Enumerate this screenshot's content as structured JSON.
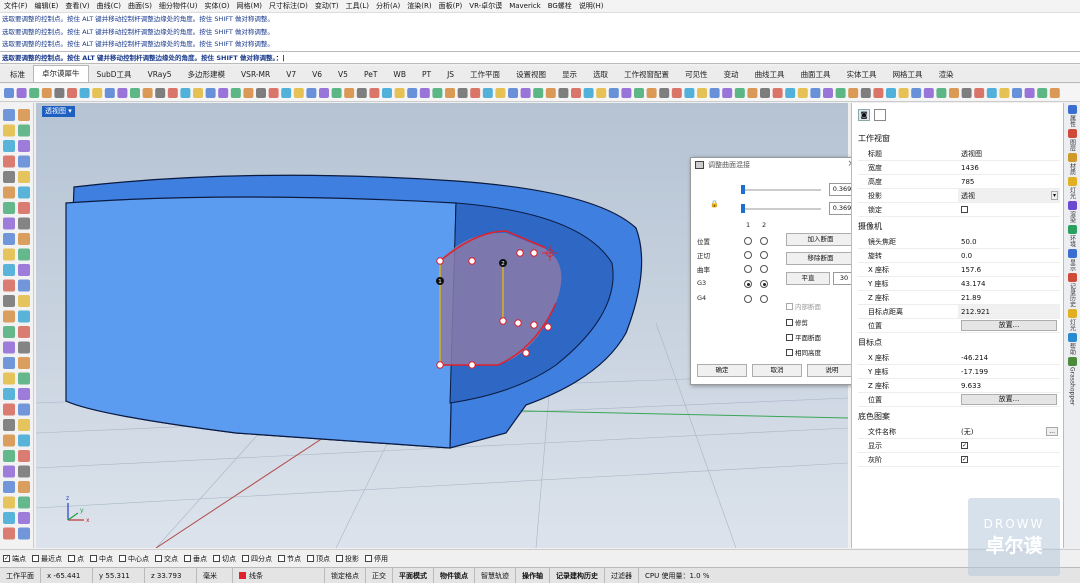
{
  "menu": [
    "文件(F)",
    "编辑(E)",
    "查看(V)",
    "曲线(C)",
    "曲面(S)",
    "细分物件(U)",
    "实体(O)",
    "网格(M)",
    "尺寸标注(D)",
    "变动(T)",
    "工具(L)",
    "分析(A)",
    "渲染(R)",
    "面板(P)",
    "VR-卓尔谟",
    "Maverick",
    "BG螺栓",
    "说明(H)"
  ],
  "command_history": [
    "选取要调整的控制点。按住 ALT 键并移动控制杆调整边缘处的角度。按住 SHIFT 做对称调整。",
    "选取要调整的控制点。按住 ALT 键并移动控制杆调整边缘处的角度。按住 SHIFT 做对称调整。",
    "选取要调整的控制点。按住 ALT 键并移动控制杆调整边缘处的角度。按住 SHIFT 做对称调整。",
    "选取要调整的控制点。按住 ALT 键并移动控制杆调整边缘处的角度。按住 SHIFT 做对称调整。"
  ],
  "command_prompt": "选取要调整的控制点。按住 ALT 键并移动控制杆调整边缘处的角度。按住 SHIFT 做对称调整。",
  "tabs": [
    "标准",
    "卓尔谟犀牛",
    "SubD工具",
    "VRay5",
    "多边形建模",
    "VSR-MR",
    "V7",
    "V6",
    "V5",
    "PeT",
    "WB",
    "PT",
    "JS",
    "工作平面",
    "设置视图",
    "显示",
    "选取",
    "工作视窗配置",
    "可见性",
    "变动",
    "曲线工具",
    "曲面工具",
    "实体工具",
    "网格工具",
    "渲染"
  ],
  "viewport_label": "透视图",
  "properties": {
    "section_viewport": "工作视窗",
    "title_k": "标题",
    "title_v": "透视图",
    "width_k": "宽度",
    "width_v": "1436",
    "height_k": "高度",
    "height_v": "785",
    "projection_k": "投影",
    "projection_v": "透视",
    "locked_k": "锁定",
    "section_camera": "摄像机",
    "lens_k": "镜头焦距",
    "lens_v": "50.0",
    "rotation_k": "旋转",
    "rotation_v": "0.0",
    "cx_k": "X 座标",
    "cx_v": "157.6",
    "cy_k": "Y 座标",
    "cy_v": "43.174",
    "cz_k": "Z 座标",
    "cz_v": "21.89",
    "dist_k": "目标点距离",
    "dist_v": "212.921",
    "pos_k": "位置",
    "place_btn": "放置...",
    "section_target": "目标点",
    "tx_k": "X 座标",
    "tx_v": "-46.214",
    "ty_k": "Y 座标",
    "ty_v": "-17.199",
    "tz_k": "Z 座标",
    "tz_v": "9.633",
    "tpos_k": "位置",
    "place_btn2": "放置...",
    "section_bg": "底色图案",
    "file_k": "文件名称",
    "file_v": "(无)",
    "show_k": "显示",
    "gray_k": "灰阶"
  },
  "right_tabs": [
    "属性",
    "图层",
    "材质",
    "灯光",
    "渲染",
    "环境",
    "显示",
    "记录历史",
    "灯光",
    "帮助",
    "Grasshopper"
  ],
  "dialog": {
    "title": "调整曲面混接",
    "val1": "0.369",
    "val2": "0.369",
    "col1": "1",
    "col2": "2",
    "rows": [
      "位置",
      "正切",
      "曲率",
      "G3",
      "G4"
    ],
    "add_section": "加入断面",
    "remove_section": "移除断面",
    "flat": "平直",
    "flat_val": "30",
    "inner_section": "内部断面",
    "trim": "修剪",
    "planar_section": "平面断面",
    "same_height": "相同高度",
    "ok": "确定",
    "cancel": "取消",
    "help": "说明"
  },
  "snap": [
    "端点",
    "最近点",
    "点",
    "中点",
    "中心点",
    "交点",
    "垂点",
    "切点",
    "四分点",
    "节点",
    "顶点",
    "投影",
    "停用"
  ],
  "status": {
    "plane": "工作平面",
    "x": "x -65.441",
    "y": "y 55.311",
    "z": "z 33.793",
    "unit": "毫米",
    "layer": "线条",
    "lock": "锁定格点",
    "ortho": "正交",
    "planar": "平面模式",
    "osnap": "物件锁点",
    "smart": "智慧轨迹",
    "gumball": "操作轴",
    "history": "记录建构历史",
    "filter": "过滤器",
    "cpu": "CPU 使用量：1.0 %"
  },
  "watermark": {
    "line1": "DROWW",
    "line2": "卓尔谟"
  },
  "colors": {
    "surface": "#4d8fe8",
    "edge": "#e0202a",
    "selection": "#1f5fbf"
  }
}
